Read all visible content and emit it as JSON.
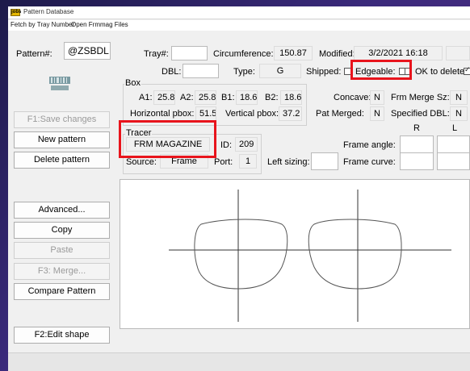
{
  "window": {
    "title": "Pattern Database",
    "app_icon_text": "jobs"
  },
  "menu": {
    "fetch_label": "Fetch by Tray Number",
    "open_label": "Open Frmmag Files"
  },
  "pattern": {
    "label": "Pattern#:",
    "value": "@ZSBDL",
    "barcode_text": "DIGITAL ZSBDL"
  },
  "header": {
    "tray_label": "Tray#:",
    "tray_value": "",
    "circ_label": "Circumference:",
    "circ_value": "150.87",
    "modified_label": "Modified:",
    "modified_value": "3/2/2021 16:18",
    "dbl_label": "DBL:",
    "dbl_value": "",
    "type_label": "Type:",
    "type_value": "G",
    "shipped_label": "Shipped:",
    "edgeable_label": "Edgeable:",
    "okdelete_label": "OK to delete:"
  },
  "box": {
    "group_label": "Box",
    "a1_label": "A1:",
    "a1_value": "25.8",
    "a2_label": "A2:",
    "a2_value": "25.8",
    "b1_label": "B1:",
    "b1_value": "18.6",
    "b2_label": "B2:",
    "b2_value": "18.6",
    "hpbox_label": "Horizontal pbox:",
    "hpbox_value": "51.5",
    "vpbox_label": "Vertical pbox:",
    "vpbox_value": "37.2"
  },
  "props": {
    "concave_label": "Concave:",
    "concave_value": "N",
    "frm_merge_label": "Frm Merge Sz:",
    "frm_merge_value": "N",
    "pat_merged_label": "Pat Merged:",
    "pat_merged_value": "N",
    "spec_dbl_label": "Specified DBL:",
    "spec_dbl_value": "N"
  },
  "tracer": {
    "group_label": "Tracer",
    "name_value": "FRM MAGAZINE",
    "id_label": "ID:",
    "id_value": "209",
    "source_label": "Source:",
    "source_value": "Frame",
    "port_label": "Port:",
    "port_value": "1"
  },
  "frame": {
    "r_header": "R",
    "l_header": "L",
    "left_sizing_label": "Left sizing:",
    "angle_label": "Frame angle:",
    "curve_label": "Frame curve:"
  },
  "buttons": {
    "save": "F1:Save changes",
    "new_pattern": "New pattern",
    "delete_pattern": "Delete pattern",
    "advanced": "Advanced...",
    "copy": "Copy",
    "paste": "Paste",
    "merge": "F3: Merge...",
    "compare": "Compare Pattern",
    "edit_shape": "F2:Edit shape"
  },
  "colors": {
    "highlight": "#e8141c"
  }
}
